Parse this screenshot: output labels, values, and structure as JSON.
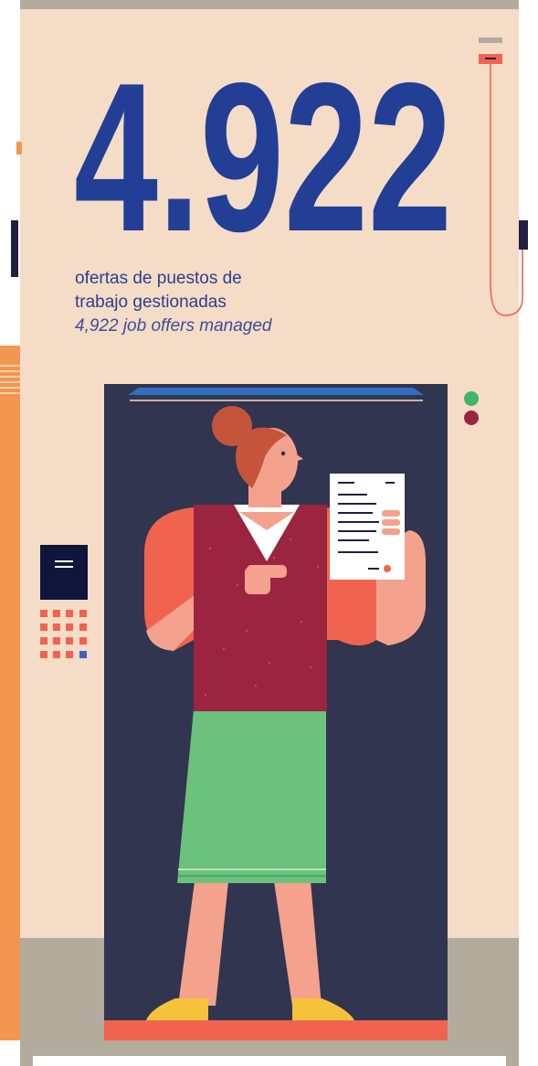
{
  "stat": {
    "number": "4.922",
    "caption_es_line1": "ofertas de puestos de",
    "caption_es_line2": "trabajo gestionadas",
    "caption_en": "4,922 job offers managed"
  },
  "colors": {
    "background_panel": "#f5dcc6",
    "number_blue": "#233f95",
    "elevator_navy": "#31354f",
    "floor_gray": "#b3ab9b",
    "orange_wall": "#f39650",
    "coral": "#f0644f",
    "skirt_green": "#6cc17d",
    "blouse_red": "#9b2440",
    "shoe_yellow": "#f7c23b",
    "skin": "#f4a28d",
    "hair": "#c4553b"
  },
  "icons": {
    "panel_button": "hamburger-icon",
    "document": "document-icon"
  }
}
